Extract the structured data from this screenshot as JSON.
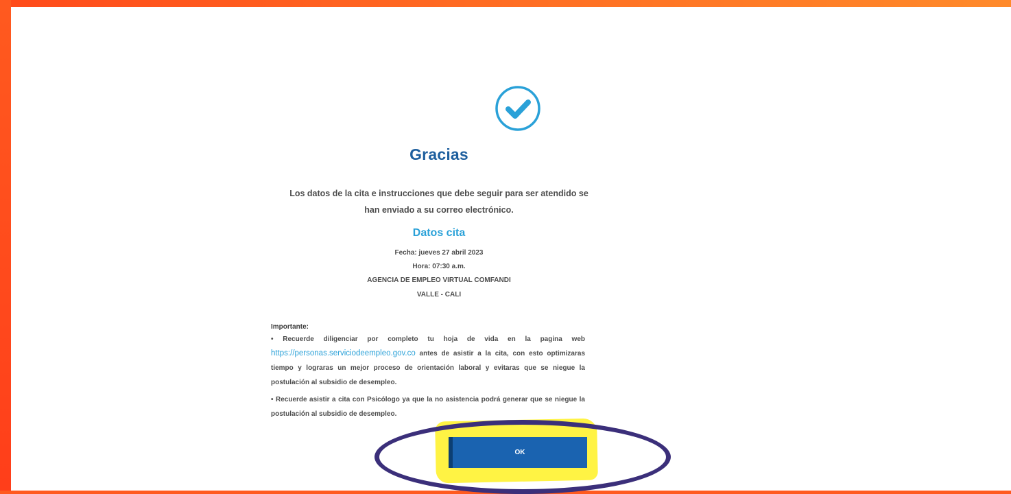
{
  "dialog": {
    "title": "Gracias",
    "message_line1": "Los datos de la cita e instrucciones que debe seguir para ser atendido se",
    "message_line2": "han enviado a su correo electrónico.",
    "datos_title": "Datos cita",
    "fecha": "Fecha: jueves 27 abril 2023",
    "hora": "Hora: 07:30 a.m.",
    "agencia": "AGENCIA DE EMPLEO VIRTUAL COMFANDI",
    "ubicacion": "VALLE - CALI",
    "importante_title": "Importante:",
    "note1_before_link": "• Recuerde diligenciar por completo tu hoja de vida en la pagina web",
    "note1_link": "https://personas.serviciodeempleo.gov.co",
    "note1_after_link": "antes de asistir a la cita, con esto optimizaras tiempo y lograras un mejor proceso de orientación laboral y evitaras que se niegue la postulación al subsidio de desempleo.",
    "note2": "• Recuerde asistir a cita con Psicólogo ya que la no asistencia podrá generar que se niegue la postulación al subsidio de desempleo.",
    "ok_label": "OK"
  },
  "colors": {
    "accent": "#1a63b0",
    "title": "#1e5f9e",
    "link": "#2aa1d8",
    "frame": "#ff5a1f",
    "highlight": "#fff23a",
    "annotation_circle": "#3b2f7a"
  },
  "icons": {
    "success": "check-circle-icon"
  }
}
